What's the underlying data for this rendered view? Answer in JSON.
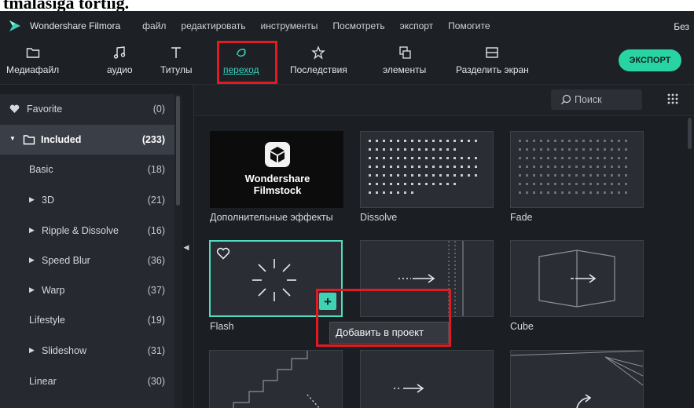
{
  "page_header": {
    "text": "tmalasiga tortiig."
  },
  "app": {
    "title": "Wondershare Filmora",
    "title_right": "Без"
  },
  "menu": [
    "файл",
    "редактировать",
    "инструменты",
    "Посмотреть",
    "экспорт",
    "Помогите"
  ],
  "toolbar": {
    "items": [
      {
        "label": "Медиафайл",
        "icon": "folder-icon",
        "active": false
      },
      {
        "label": "аудио",
        "icon": "music-note-icon",
        "active": false
      },
      {
        "label": "Титулы",
        "icon": "text-icon",
        "active": false
      },
      {
        "label": "переход",
        "icon": "transition-icon",
        "active": true
      },
      {
        "label": "Последствия",
        "icon": "effects-icon",
        "active": false
      },
      {
        "label": "элементы",
        "icon": "elements-icon",
        "active": false
      },
      {
        "label": "Разделить экран",
        "icon": "split-screen-icon",
        "active": false
      }
    ],
    "export_label": "ЭКСПОРТ"
  },
  "sidebar": {
    "items": [
      {
        "name": "Favorite",
        "count": "(0)",
        "icon": "heart-icon",
        "active": false
      },
      {
        "name": "Included",
        "count": "(233)",
        "icon": "folder-icon",
        "expanded": true,
        "active": true
      },
      {
        "name": "Basic",
        "count": "(18)"
      },
      {
        "name": "3D",
        "count": "(21)",
        "arrow": true
      },
      {
        "name": "Ripple & Dissolve",
        "count": "(16)",
        "arrow": true
      },
      {
        "name": "Speed Blur",
        "count": "(36)",
        "arrow": true
      },
      {
        "name": "Warp",
        "count": "(37)",
        "arrow": true
      },
      {
        "name": "Lifestyle",
        "count": "(19)"
      },
      {
        "name": "Slideshow",
        "count": "(31)",
        "arrow": true
      },
      {
        "name": "Linear",
        "count": "(30)"
      }
    ]
  },
  "search": {
    "placeholder": "Поиск"
  },
  "filmstock": {
    "line1": "Wondershare",
    "line2": "Filmstock"
  },
  "transitions": [
    {
      "label": "Дополнительные эффекты",
      "thumb": "filmstock"
    },
    {
      "label": "Dissolve",
      "thumb": "dots-dissolve"
    },
    {
      "label": "Fade",
      "thumb": "dots-fade"
    },
    {
      "label": "Flash",
      "thumb": "flash-rays",
      "selected": true
    },
    {
      "label": "",
      "thumb": "arrow-push"
    },
    {
      "label": "Cube",
      "thumb": "cube-arrow"
    },
    {
      "label": "",
      "thumb": "stairs"
    },
    {
      "label": "",
      "thumb": "arrow-small"
    },
    {
      "label": "",
      "thumb": "rotate"
    }
  ],
  "tooltip": {
    "text": "Добавить в проект"
  },
  "colors": {
    "accent": "#39d2bc",
    "export": "#28d4a4",
    "highlight": "#e01b24",
    "panel": "#262a30",
    "background": "#1b1e23"
  }
}
